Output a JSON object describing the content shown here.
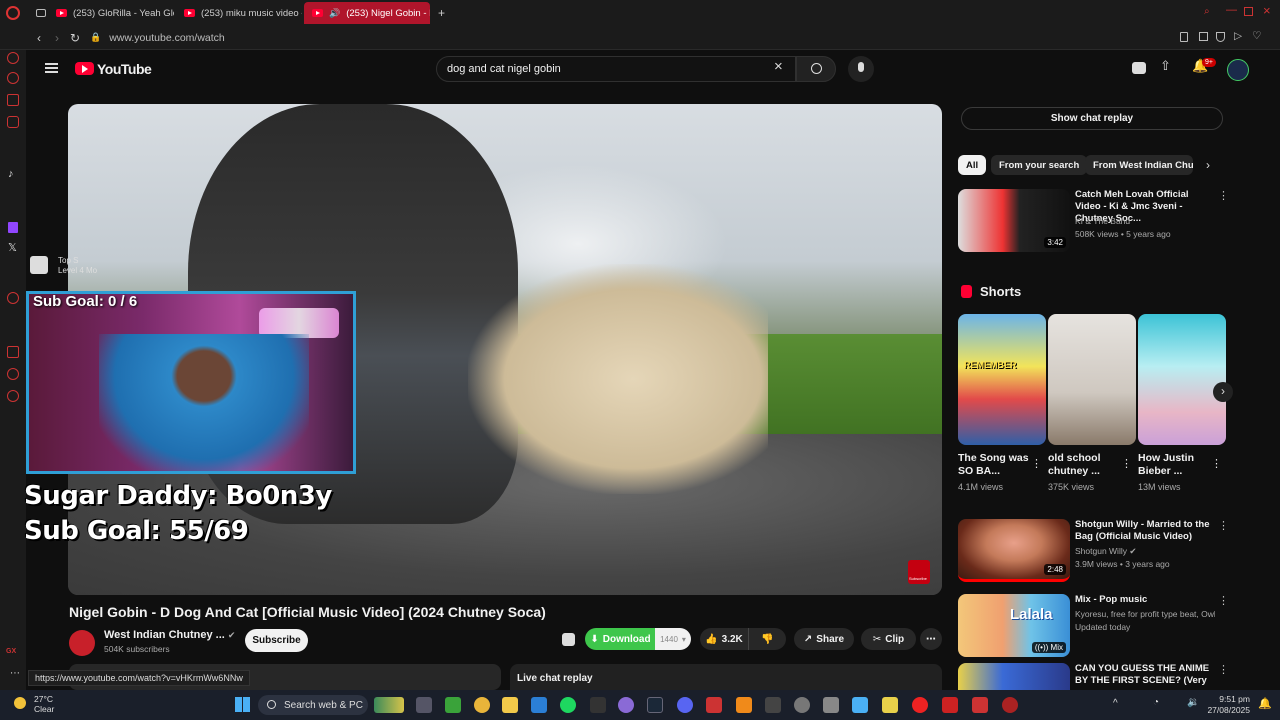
{
  "browser": {
    "tabs": [
      {
        "label": "(253) GloRilla - Yeah Glo!",
        "active": false
      },
      {
        "label": "(253) miku music video -",
        "active": false
      },
      {
        "label": "(253) Nigel Gobin - D",
        "active": true
      }
    ],
    "url": "www.youtube.com/watch",
    "status_url": "https://www.youtube.com/watch?v=vHKrmWw6NNw"
  },
  "header": {
    "logo": "YouTube",
    "search_value": "dog and cat nigel gobin",
    "notification_badge": "9+"
  },
  "video": {
    "title": "Nigel Gobin - D Dog And Cat [Official Music Video] (2024 Chutney Soca)",
    "overlay_top_label_1": "Top S",
    "overlay_top_label_2": "Level 4 Mo",
    "overlay_subgoal_small": "Sub Goal: 0 / 6",
    "overlay_line1": "Sugar Daddy: Bo0n3y",
    "overlay_line2": "Sub Goal: 55/69",
    "subscribe_watermark": "Subscribe"
  },
  "channel": {
    "name": "West Indian Chutney ...",
    "subscribers": "504K subscribers",
    "subscribe_label": "Subscribe"
  },
  "actions": {
    "download": "Download",
    "download_count": "1440",
    "likes": "3.2K",
    "share": "Share",
    "clip": "Clip"
  },
  "live_chat_replay": "Live chat replay",
  "sidebar": {
    "show_chat_replay": "Show chat replay",
    "chips": [
      "All",
      "From your search",
      "From West Indian Chutn"
    ],
    "recs_top": [
      {
        "title": "Catch Meh Lovah Official Video - Ki & Jmc 3veni - Chutney Soc...",
        "channel": "KI & The Band",
        "meta": "508K views • 5 years ago",
        "duration": "3:42"
      }
    ],
    "shorts_heading": "Shorts",
    "shorts": [
      {
        "title": "The Song was SO BA...",
        "views": "4.1M views",
        "thumb_label": "REMEMBER"
      },
      {
        "title": "old school chutney ...",
        "views": "375K views"
      },
      {
        "title": "How Justin Bieber ...",
        "views": "13M views"
      }
    ],
    "recs_bottom": [
      {
        "title": "Shotgun Willy - Married to the Bag (Official Music Video)",
        "channel": "Shotgun Willy",
        "meta": "3.9M views • 3 years ago",
        "duration": "2:48"
      },
      {
        "title": "Mix - Pop music",
        "channel": "Kyoresu, free for profit type beat, Owl Cit...",
        "meta": "Updated today",
        "duration": "Mix",
        "thumb_label": "Lalala"
      },
      {
        "title": "CAN YOU GUESS THE ANIME BY THE FIRST SCENE? (Very ...",
        "channel": "",
        "meta": "",
        "duration": ""
      }
    ]
  },
  "taskbar": {
    "temp": "27°C",
    "weather": "Clear",
    "search_placeholder": "Search web & PC",
    "time": "9:51 pm",
    "date": "27/08/2025"
  },
  "colors": {
    "youtube_red": "#ff0033",
    "active_tab": "#b0152b",
    "download_green": "#3ec64b",
    "webcam_border": "#2f9fd6"
  }
}
